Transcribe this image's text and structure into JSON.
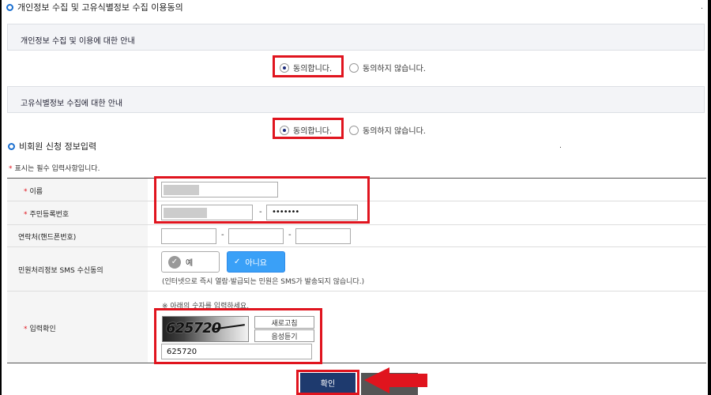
{
  "header": {
    "title": "개인정보 수집 및 고유식별정보 수집 이용동의"
  },
  "privacy": {
    "guide_label": "개인정보 수집 및 이용에 대한 안내",
    "agree_label": "동의합니다.",
    "disagree_label": "동의하지 않습니다.",
    "selected": "agree"
  },
  "unique_id": {
    "guide_label": "고유식별정보 수집에 대한 안내",
    "agree_label": "동의합니다.",
    "disagree_label": "동의하지 않습니다.",
    "selected": "agree"
  },
  "form": {
    "title": "비회원 신청 정보입력",
    "required_mark": "*",
    "required_note": "표시는 필수 입력사항입니다.",
    "name_label": "이름",
    "rrn_label": "주민등록번호",
    "rrn_dash": "-",
    "rrn_back_masked": "•••••••",
    "phone_label": "연락처(핸드폰번호)",
    "phone_dash": "-",
    "sms_label": "민원처리정보 SMS 수신동의",
    "sms_yes": "예",
    "sms_no": "아니요",
    "sms_selected": "아니요",
    "sms_note": "(인터넷으로 즉시 열람·발급되는 민원은 SMS가 발송되지 않습니다.)",
    "captcha_label": "입력확인",
    "captcha_note": "※ 아래의 숫자를 입력하세요.",
    "captcha_image_text": "625720",
    "refresh_label": "새로고침",
    "audio_label": "음성듣기",
    "captcha_value": "625720"
  },
  "actions": {
    "confirm_label": "확인"
  },
  "colors": {
    "highlight": "#e0141e",
    "primary": "#1e3a6e",
    "toggle_on": "#3aa0f7",
    "ring": "#1a6fd0"
  },
  "icons": {
    "section": "ring-icon",
    "check": "check-icon",
    "arrow": "red-arrow-icon"
  }
}
